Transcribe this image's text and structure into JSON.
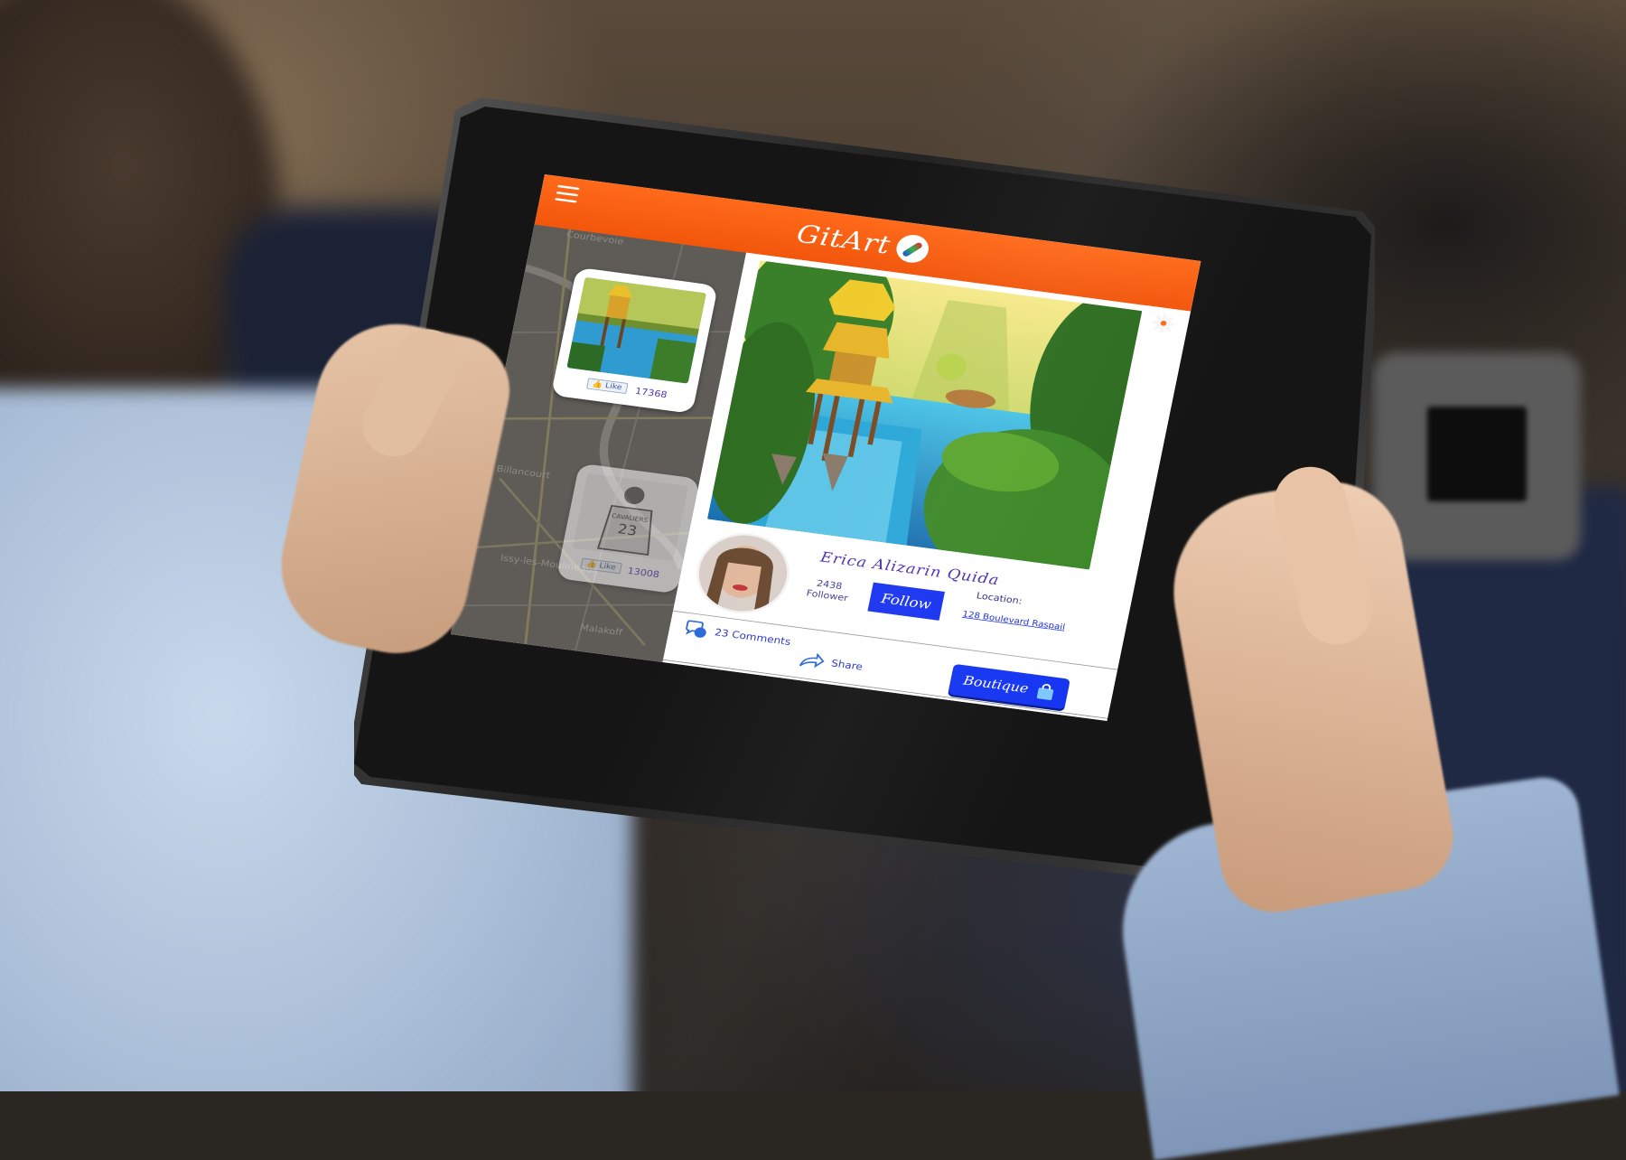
{
  "app": {
    "title": "GitArt",
    "accent_color": "#f2560c",
    "button_color": "#1733f0",
    "menu_icon": "hamburger-icon",
    "settings_icon": "gear-icon"
  },
  "map": {
    "close_icon": "close-icon",
    "labels": [
      "Courbevoie",
      "Billancourt",
      "Issy-les-Moulineaux",
      "Malakoff"
    ],
    "cards": [
      {
        "like_label": "Like",
        "likes": "17368",
        "subject": "treehouse waterfall artwork"
      },
      {
        "like_label": "Like",
        "likes": "13008",
        "subject": "basketball player sketch"
      }
    ]
  },
  "detail": {
    "artist": {
      "name": "Erica Alizarin Quida",
      "followers_count": "2438",
      "followers_label": "Follower",
      "follow_label": "Follow",
      "location_label": "Location:",
      "location_value": "128 Boulevard Raspail"
    },
    "actions": {
      "comments_label": "23 Comments",
      "share_label": "Share",
      "boutique_label": "Boutique"
    }
  }
}
